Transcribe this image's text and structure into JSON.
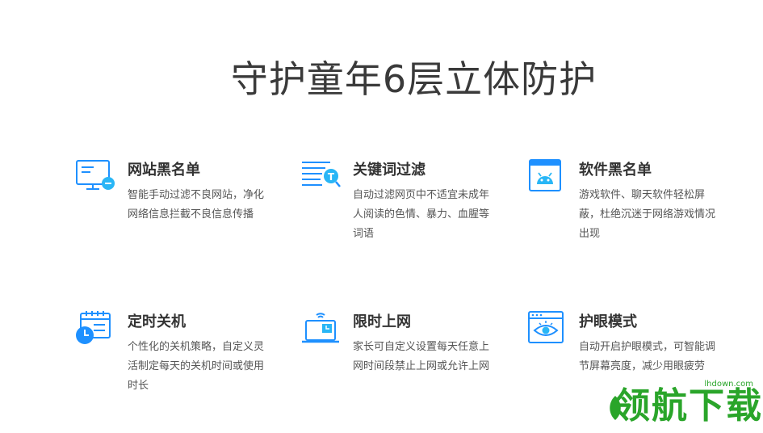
{
  "title": "守护童年6层立体防护",
  "features": [
    {
      "title": "网站黑名单",
      "desc": "智能手动过滤不良网站，净化网络信息拦截不良信息传播",
      "icon": "monitor-block-icon"
    },
    {
      "title": "关键词过滤",
      "desc": "自动过滤网页中不适宜未成年人阅读的色情、暴力、血腥等词语",
      "icon": "text-filter-icon"
    },
    {
      "title": "软件黑名单",
      "desc": "游戏软件、聊天软件轻松屏蔽，杜绝沉迷于网络游戏情况出现",
      "icon": "android-window-icon"
    },
    {
      "title": "定时关机",
      "desc": "个性化的关机策略，自定义灵活制定每天的关机时间或使用时长",
      "icon": "calendar-clock-icon"
    },
    {
      "title": "限时上网",
      "desc": "家长可自定义设置每天任意上网时间段禁止上网或允许上网",
      "icon": "laptop-wifi-icon"
    },
    {
      "title": "护眼模式",
      "desc": "自动开启护眼模式，可智能调节屏幕亮度，减少用眼疲劳",
      "icon": "eye-window-icon"
    }
  ],
  "watermark": {
    "brand": "领航下载",
    "url": "lhdown.com"
  },
  "colors": {
    "accent": "#1e90ff",
    "accent_light": "#29b6f6",
    "brand_green": "#2aa52a"
  }
}
